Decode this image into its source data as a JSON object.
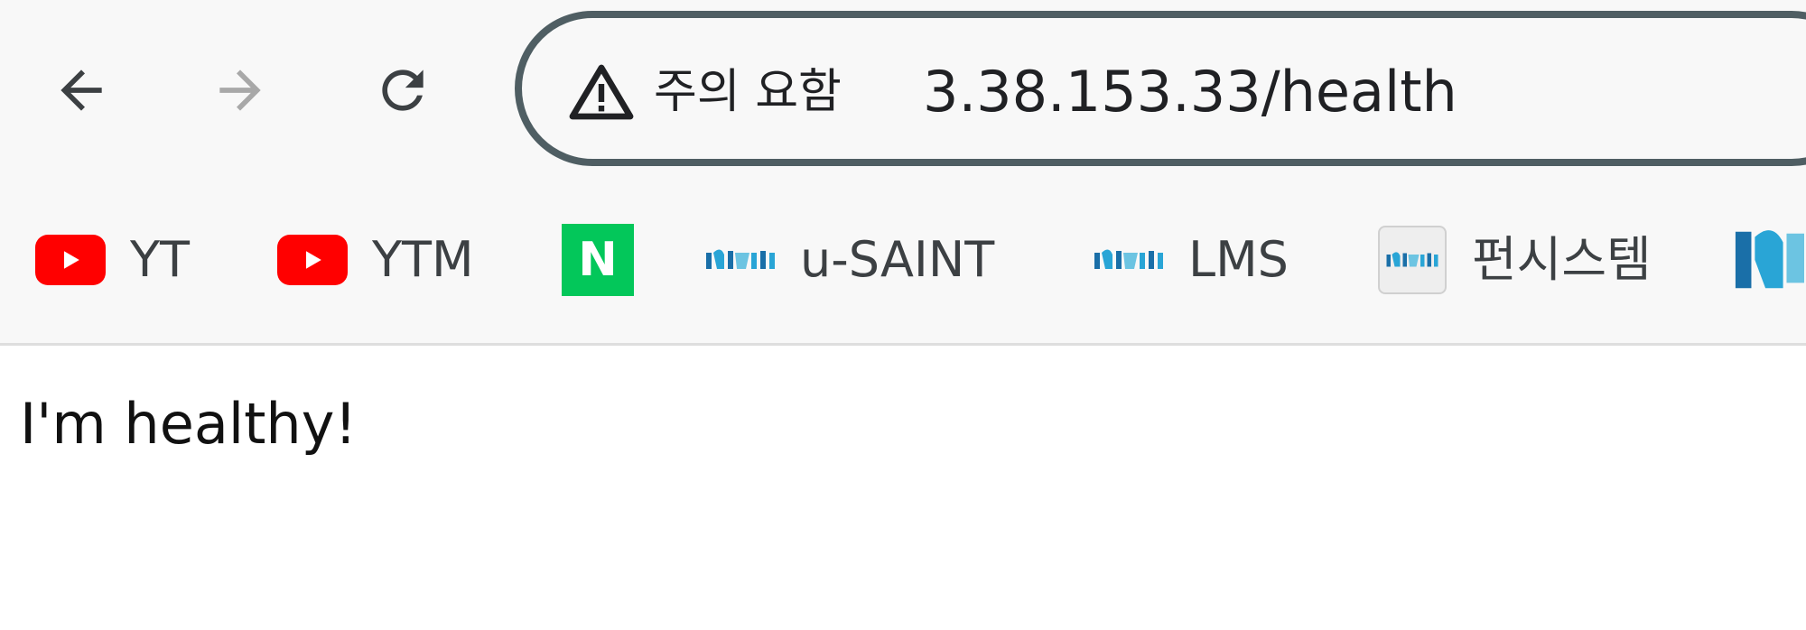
{
  "toolbar": {
    "back_icon": "arrow-left-icon",
    "forward_icon": "arrow-right-icon",
    "reload_icon": "reload-icon"
  },
  "omnibox": {
    "security_icon": "warning-triangle-icon",
    "security_label": "주의 요함",
    "url": "3.38.153.33/health",
    "border_color": "#4f5e63"
  },
  "bookmarks": [
    {
      "label": "YT",
      "icon": "youtube-icon",
      "color": "#ff0000"
    },
    {
      "label": "YTM",
      "icon": "youtube-icon",
      "color": "#ff0000"
    },
    {
      "label": "",
      "icon": "naver-icon",
      "color": "#03c75a"
    },
    {
      "label": "u-SAINT",
      "icon": "ssu-logo-icon",
      "color": "#1a8fc0"
    },
    {
      "label": "LMS",
      "icon": "ssu-logo-icon",
      "color": "#1a8fc0"
    },
    {
      "label": "펀시스템",
      "icon": "ssu-logo-icon",
      "color": "#1a8fc0"
    },
    {
      "label": "",
      "icon": "ssu-logo-icon",
      "color": "#1a8fc0"
    }
  ],
  "page": {
    "text": "I'm healthy!"
  }
}
